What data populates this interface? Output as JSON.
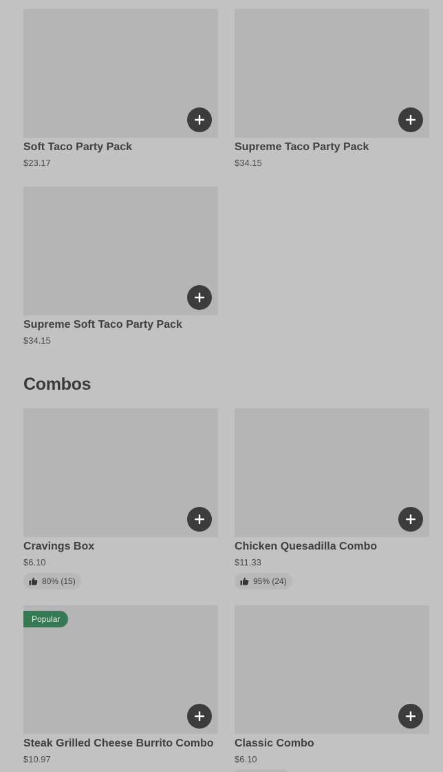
{
  "sections": {
    "combos_title": "Combos"
  },
  "items": {
    "soft_taco_party_pack": {
      "name": "Soft Taco Party Pack",
      "price": "$23.17"
    },
    "supreme_taco_party_pack": {
      "name": "Supreme Taco Party Pack",
      "price": "$34.15"
    },
    "supreme_soft_taco_party_pack": {
      "name": "Supreme Soft Taco Party Pack",
      "price": "$34.15"
    },
    "cravings_box": {
      "name": "Cravings Box",
      "price": "$6.10",
      "rating": "80% (15)"
    },
    "chicken_quesadilla_combo": {
      "name": "Chicken Quesadilla Combo",
      "price": "$11.33",
      "rating": "95% (24)"
    },
    "steak_grilled_cheese_burrito_combo": {
      "name": "Steak Grilled Cheese Burrito Combo",
      "price": "$10.97",
      "badge": "Popular"
    },
    "classic_combo": {
      "name": "Classic Combo",
      "price": "$6.10"
    }
  },
  "icons": {
    "add": "plus-icon",
    "rating": "thumbs-up-icon"
  },
  "colors": {
    "background": "#c2c2c2",
    "image_placeholder": "#b5b5b5",
    "add_button": "#3c3c3c",
    "popular_badge": "#347a52",
    "rating_pill": "#b8b8b8"
  }
}
